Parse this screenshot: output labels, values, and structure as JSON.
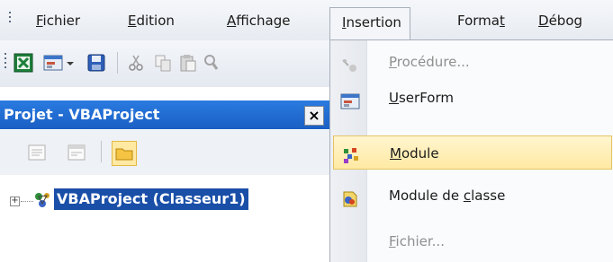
{
  "menubar": {
    "items": [
      {
        "label": "Fichier",
        "mnemonic": "F"
      },
      {
        "label": "Edition",
        "mnemonic": "E"
      },
      {
        "label": "Affichage",
        "mnemonic": "A"
      },
      {
        "label": "Insertion",
        "mnemonic": "I",
        "open": true
      },
      {
        "label": "Format",
        "mnemonic": "t"
      },
      {
        "label": "Débog",
        "mnemonic": "D"
      }
    ]
  },
  "toolbar": {
    "buttons": [
      "excel-icon",
      "userform-insert-icon",
      "dropdown-arrow-icon",
      "save-icon",
      "cut-icon",
      "copy-icon",
      "paste-icon",
      "find-icon"
    ]
  },
  "project_explorer": {
    "title": "Projet - VBAProject",
    "close_label": "×",
    "toolbar_buttons": [
      "view-code-icon",
      "view-object-icon",
      "toggle-folders-icon"
    ],
    "tree": [
      {
        "label": "VBAProject (Classeur1)",
        "expand_symbol": "+",
        "selected": true,
        "icon": "vbaproject-icon"
      }
    ]
  },
  "insertion_menu": {
    "items": [
      {
        "label": "Procédure...",
        "mnemonic": "P",
        "enabled": false,
        "icon": "procedure-icon"
      },
      {
        "label": "UserForm",
        "mnemonic": "U",
        "enabled": true,
        "icon": "userform-icon"
      },
      {
        "label": "Module",
        "mnemonic": "M",
        "enabled": true,
        "highlighted": true,
        "icon": "module-icon"
      },
      {
        "label": "Module de classe",
        "mnemonic": "c",
        "enabled": true,
        "icon": "class-module-icon"
      },
      {
        "label": "Fichier...",
        "mnemonic": "F",
        "enabled": false,
        "icon": ""
      }
    ]
  },
  "colors": {
    "menu_highlight": "#ffe9a3",
    "project_header": "#1a5fc4",
    "tree_selection": "#1a4fa8"
  }
}
